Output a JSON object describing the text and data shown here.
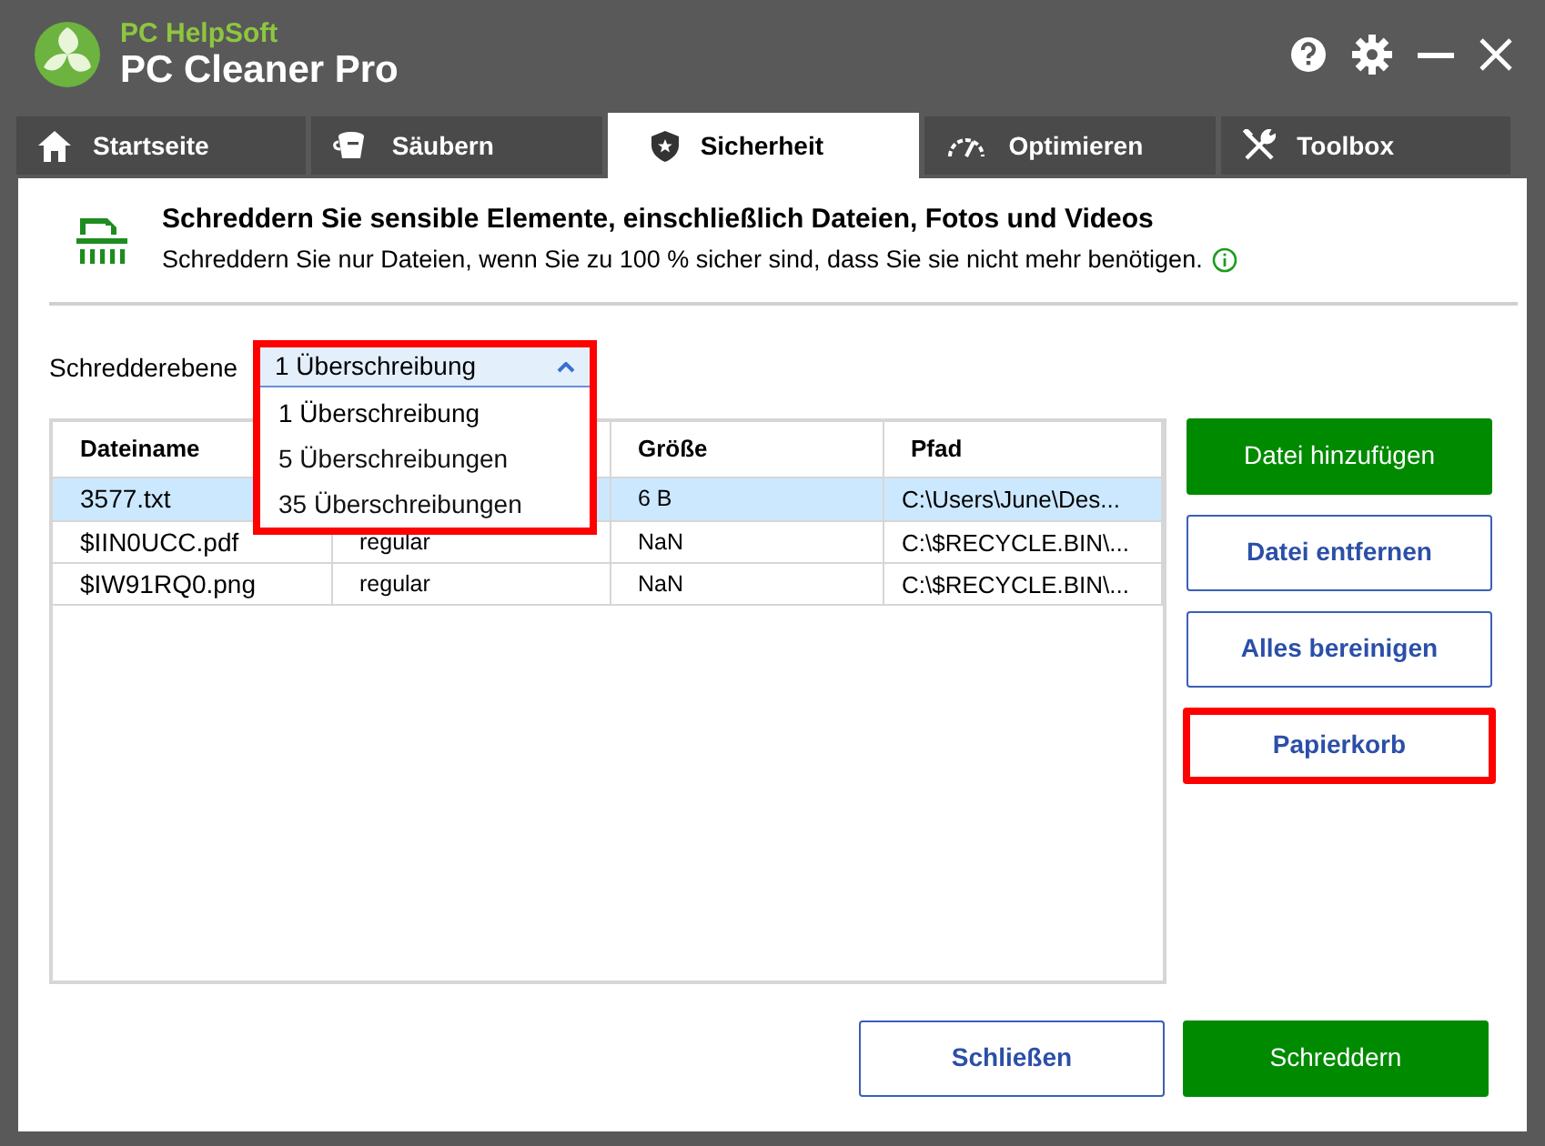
{
  "app": {
    "brand": "PC HelpSoft",
    "title": "PC Cleaner Pro"
  },
  "tabs": [
    {
      "label": "Startseite",
      "kind": "home",
      "selected": false
    },
    {
      "label": "Säubern",
      "kind": "clean",
      "selected": false
    },
    {
      "label": "Sicherheit",
      "kind": "shield",
      "selected": true
    },
    {
      "label": "Optimieren",
      "kind": "gauge",
      "selected": false
    },
    {
      "label": "Toolbox",
      "kind": "tools",
      "selected": false
    }
  ],
  "intro": {
    "heading": "Schreddern Sie sensible Elemente, einschließlich Dateien, Fotos und Videos",
    "text": "Schreddern Sie nur Dateien, wenn Sie zu 100 % sicher sind, dass Sie sie nicht mehr benötigen."
  },
  "shred_level": {
    "label": "Schredderebene",
    "value": "1 Überschreibung",
    "expanded": true,
    "highlighted": true,
    "options": [
      {
        "label": "1 Überschreibung",
        "selected": true
      },
      {
        "label": "5 Überschreibungen",
        "selected": false
      },
      {
        "label": "35 Überschreibungen",
        "selected": false
      }
    ]
  },
  "table": {
    "columns": [
      "Dateiname",
      "",
      "Größe",
      "Pfad"
    ],
    "rows": [
      {
        "cells": [
          "3577.txt",
          "",
          "6 B",
          "C:\\Users\\June\\Des..."
        ],
        "selected": true
      },
      {
        "cells": [
          "$IIN0UCC.pdf",
          "regular",
          "NaN",
          "C:\\$RECYCLE.BIN\\..."
        ],
        "selected": false
      },
      {
        "cells": [
          "$IW91RQ0.png",
          "regular",
          "NaN",
          "C:\\$RECYCLE.BIN\\..."
        ],
        "selected": false
      }
    ]
  },
  "side_buttons": [
    {
      "label": "Datei hinzufügen",
      "kind": "primary",
      "highlighted": false
    },
    {
      "label": "Datei entfernen",
      "kind": "outline",
      "highlighted": false
    },
    {
      "label": "Alles bereinigen",
      "kind": "outline",
      "highlighted": false
    },
    {
      "label": "Papierkorb",
      "kind": "outline",
      "highlighted": true
    }
  ],
  "footer_buttons": [
    {
      "label": "Schließen",
      "kind": "outline"
    },
    {
      "label": "Schreddern",
      "kind": "primary"
    }
  ]
}
